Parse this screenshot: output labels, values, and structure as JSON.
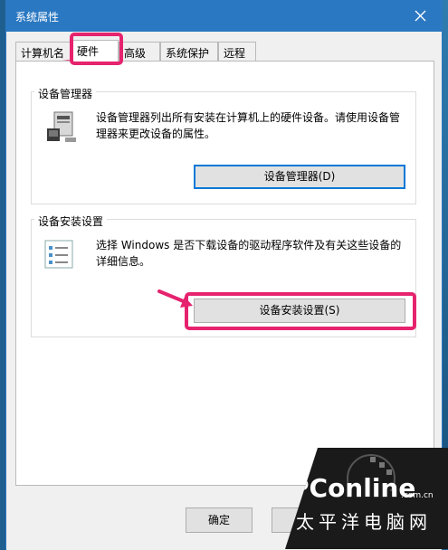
{
  "window": {
    "title": "系统属性"
  },
  "tabs": [
    {
      "label": "计算机名",
      "active": false
    },
    {
      "label": "硬件",
      "active": true
    },
    {
      "label": "高级",
      "active": false
    },
    {
      "label": "系统保护",
      "active": false
    },
    {
      "label": "远程",
      "active": false
    }
  ],
  "device_manager": {
    "group_label": "设备管理器",
    "description": "设备管理器列出所有安装在计算机上的硬件设备。请使用设备管理器来更改设备的属性。",
    "button_label": "设备管理器(D)"
  },
  "device_install": {
    "group_label": "设备安装设置",
    "description": "选择 Windows 是否下载设备的驱动程序软件及有关这些设备的详细信息。",
    "button_label": "设备安装设置(S)"
  },
  "footer": {
    "ok_label": "确定"
  },
  "watermark": {
    "brand": "PConline",
    "domain": ".com.cn",
    "slogan": "太平洋电脑网"
  },
  "colors": {
    "titlebar": "#2b78c2",
    "highlight": "#e6236e",
    "default_button_border": "#0078d7"
  }
}
